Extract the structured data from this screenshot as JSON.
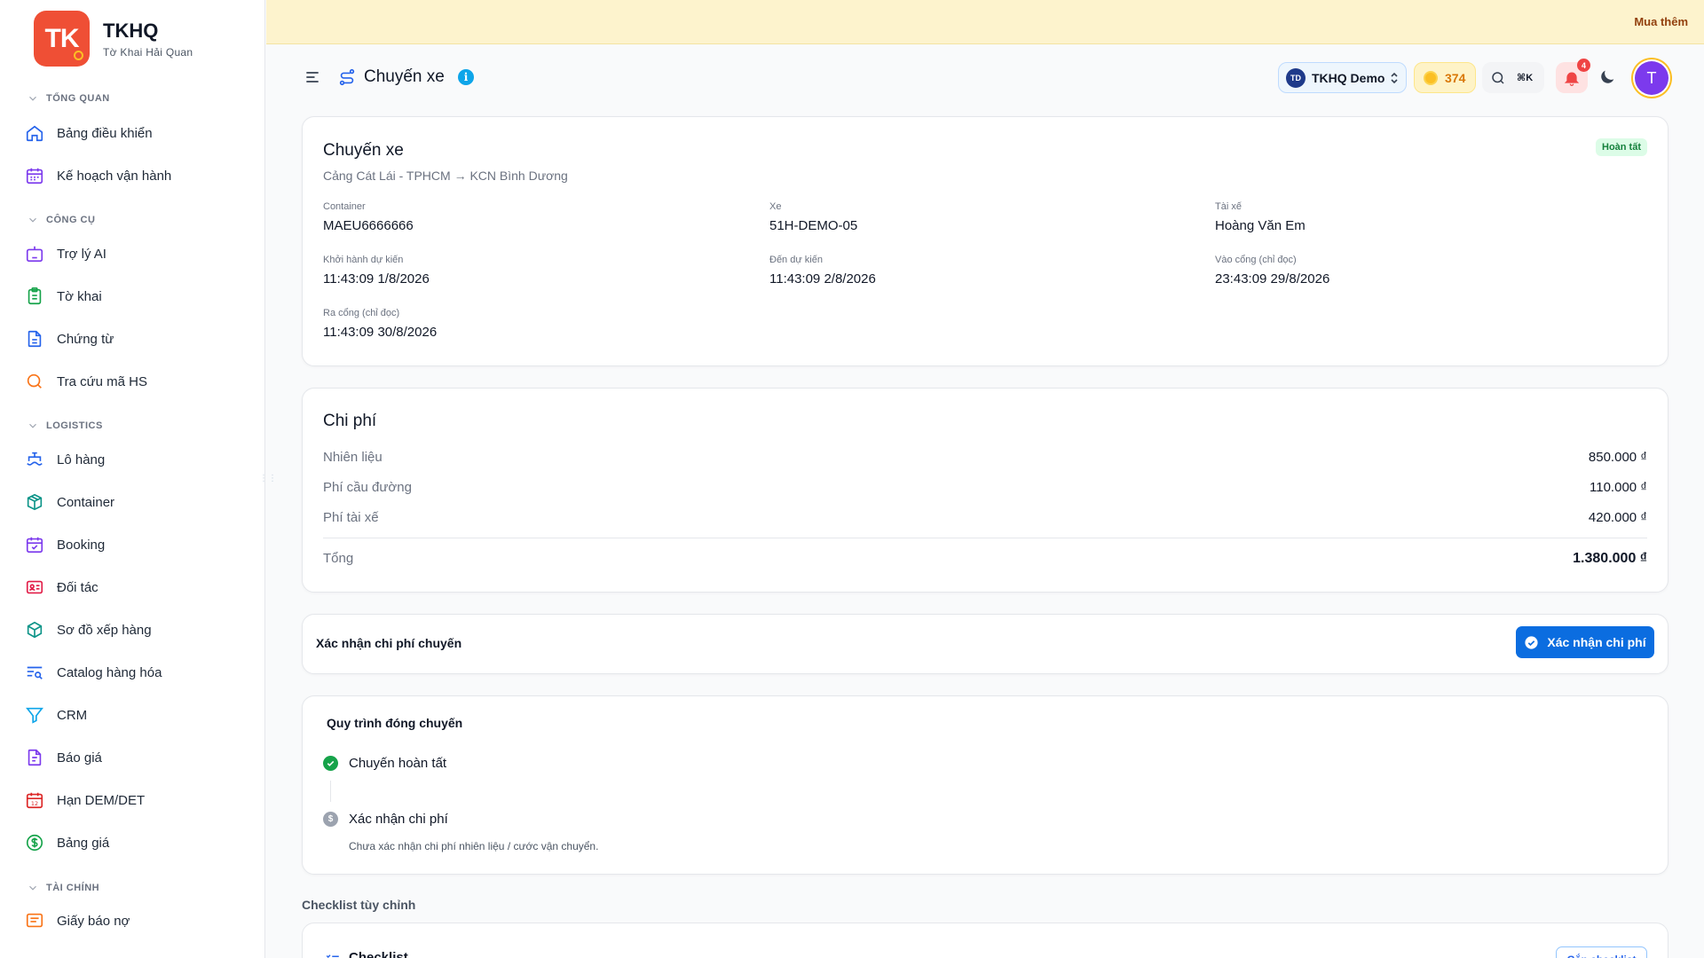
{
  "banner": {
    "link_label": "Mua thêm"
  },
  "brand": {
    "logo_text": "TK",
    "name": "TKHQ",
    "subtitle": "Tờ Khai Hải Quan"
  },
  "sidebar": {
    "sections": [
      {
        "label": "TỔNG QUAN"
      },
      {
        "label": "CÔNG CỤ"
      },
      {
        "label": "LOGISTICS"
      },
      {
        "label": "TÀI CHÍNH"
      }
    ],
    "items": [
      {
        "label": "Bảng điều khiển",
        "icon": "home-icon"
      },
      {
        "label": "Kế hoạch vận hành",
        "icon": "calendar-icon"
      },
      {
        "label": "Trợ lý AI",
        "icon": "bot-icon"
      },
      {
        "label": "Tờ khai",
        "icon": "clipboard-icon"
      },
      {
        "label": "Chứng từ",
        "icon": "file-icon"
      },
      {
        "label": "Tra cứu mã HS",
        "icon": "search-icon"
      },
      {
        "label": "Lô hàng",
        "icon": "ship-icon"
      },
      {
        "label": "Container",
        "icon": "box-icon"
      },
      {
        "label": "Booking",
        "icon": "calendar-check-icon"
      },
      {
        "label": "Đối tác",
        "icon": "id-card-icon"
      },
      {
        "label": "Sơ đồ xếp hàng",
        "icon": "cube-icon"
      },
      {
        "label": "Catalog hàng hóa",
        "icon": "list-search-icon"
      },
      {
        "label": "CRM",
        "icon": "filter-icon"
      },
      {
        "label": "Báo giá",
        "icon": "document-icon"
      },
      {
        "label": "Hạn DEM/DET",
        "icon": "calendar-12-icon"
      },
      {
        "label": "Bảng giá",
        "icon": "dollar-circle-icon"
      },
      {
        "label": "Giấy báo nợ",
        "icon": "message-square-icon"
      }
    ]
  },
  "header": {
    "title": "Chuyến xe",
    "info_glyph": "i",
    "org_badge": "TD",
    "org_name": "TKHQ Demo",
    "credits": "374",
    "search_shortcut": "⌘K",
    "notification_count": "4",
    "avatar_initial": "T"
  },
  "trip": {
    "title": "Chuyến xe",
    "route": "Cảng Cát Lái - TPHCM → KCN Bình Dương",
    "status": "Hoàn tất",
    "fields": [
      {
        "label": "Container",
        "value": "MAEU6666666"
      },
      {
        "label": "Xe",
        "value": "51H-DEMO-05"
      },
      {
        "label": "Tài xế",
        "value": "Hoàng Văn Em"
      },
      {
        "label": "Khởi hành dự kiến",
        "value": "11:43:09 1/8/2026"
      },
      {
        "label": "Đến dự kiến",
        "value": "11:43:09 2/8/2026"
      },
      {
        "label": "Vào cổng (chỉ đọc)",
        "value": "23:43:09 29/8/2026"
      },
      {
        "label": "Ra cổng (chỉ đọc)",
        "value": "11:43:09 30/8/2026"
      }
    ]
  },
  "costs": {
    "title": "Chi phí",
    "rows": [
      {
        "label": "Nhiên liệu",
        "value": "850.000 ₫"
      },
      {
        "label": "Phí cầu đường",
        "value": "110.000 ₫"
      },
      {
        "label": "Phí tài xế",
        "value": "420.000 ₫"
      }
    ],
    "total_label": "Tổng",
    "total_value": "1.380.000 ₫"
  },
  "confirm": {
    "label": "Xác nhận chi phí chuyến",
    "button_label": "Xác nhận chi phí"
  },
  "workflow": {
    "title": "Quy trình đóng chuyến",
    "steps": [
      {
        "label": "Chuyến hoàn tất",
        "state": "done",
        "color": "#16a34a"
      },
      {
        "label": "Xác nhận chi phí",
        "state": "pending",
        "color": "#9ca3af",
        "glyph": "$",
        "description": "Chưa xác nhận chi phí nhiên liệu / cước vận chuyển."
      }
    ]
  },
  "checklist": {
    "section_label": "Checklist tùy chỉnh",
    "title": "Checklist",
    "attach_label": "Gắn checklist"
  }
}
